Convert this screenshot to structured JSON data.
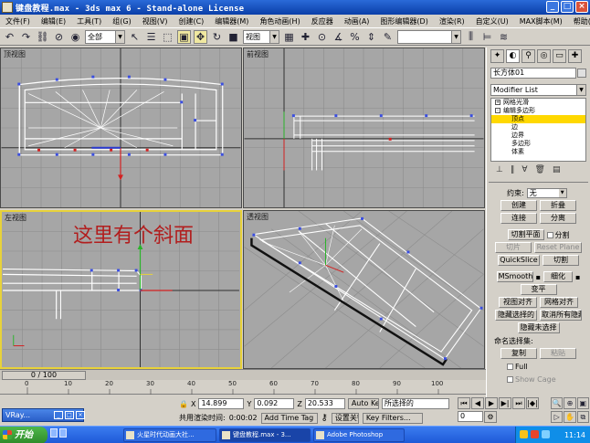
{
  "window": {
    "title": "键盘教程.max - 3ds max 6 - Stand-alone License",
    "buttons": {
      "minimize": "_",
      "maximize": "□",
      "close": "×"
    }
  },
  "menu": [
    "文件(F)",
    "编辑(E)",
    "工具(T)",
    "组(G)",
    "视图(V)",
    "创建(C)",
    "编辑器(M)",
    "角色动画(H)",
    "反应器",
    "动画(A)",
    "图形编辑器(D)",
    "渲染(R)",
    "自定义(U)",
    "MAX脚本(M)",
    "帮助(H)"
  ],
  "toolbar": {
    "selection_filter": "全部",
    "ref_coord": "视图"
  },
  "viewports": {
    "top": "顶视图",
    "front": "前视图",
    "left": "左视图",
    "perspective": "透视图"
  },
  "annotation": "这里有个斜面",
  "command_panel": {
    "object_name": "长方体01",
    "modifier_list": "Modifier List",
    "stack": [
      {
        "label": "网格光滑",
        "level": 0
      },
      {
        "label": "编辑多边形",
        "level": 0
      },
      {
        "label": "顶点",
        "level": 1,
        "selected": true
      },
      {
        "label": "边",
        "level": 1
      },
      {
        "label": "边界",
        "level": 1
      },
      {
        "label": "多边形",
        "level": 1
      },
      {
        "label": "体素",
        "level": 1
      }
    ],
    "constraint_label": "约束:",
    "constraint_value": "无",
    "buttons": {
      "create": "创建",
      "collapse": "折叠",
      "attach": "连接",
      "detach": "分离",
      "slice_plane": "切割平面",
      "split": "分割",
      "slice": "切片",
      "reset_plane": "Reset Plane",
      "quickslice": "QuickSlice",
      "cut": "切割",
      "msmooth": "MSmooth",
      "tessellate": "细化",
      "planarize": "变平",
      "view_align": "视图对齐",
      "grid_align": "网格对齐",
      "hide_selected": "隐藏选择的",
      "unhide_all": "取消所有隐藏",
      "hide_unselected": "隐藏未选择",
      "named_sel_label": "命名选择集:",
      "copy": "复制",
      "paste": "粘贴",
      "full": "Full",
      "show_cage": "Show Cage"
    }
  },
  "timeline": {
    "slider": "0 / 100",
    "ticks": [
      "0",
      "10",
      "20",
      "30",
      "40",
      "50",
      "60",
      "70",
      "80",
      "90",
      "100"
    ]
  },
  "status": {
    "x_label": "X",
    "x": "14.899",
    "y_label": "Y",
    "y": "0.092",
    "z_label": "Z",
    "z": "20.533",
    "auto_key": "Auto Key",
    "selected": "所选择的",
    "set_key": "设置关键帧",
    "key_filters": "Key Filters...",
    "render_time": "共用渲染时间:",
    "time": "0:00:02",
    "add_time_tag": "Add Time Tag",
    "frame": "0"
  },
  "vray": "VRay...",
  "taskbar": {
    "start": "开始",
    "tasks": [
      "火星时代动画大社...",
      "键盘教程.max - 3...",
      "Adobe Photoshop"
    ],
    "clock": "11:14"
  }
}
